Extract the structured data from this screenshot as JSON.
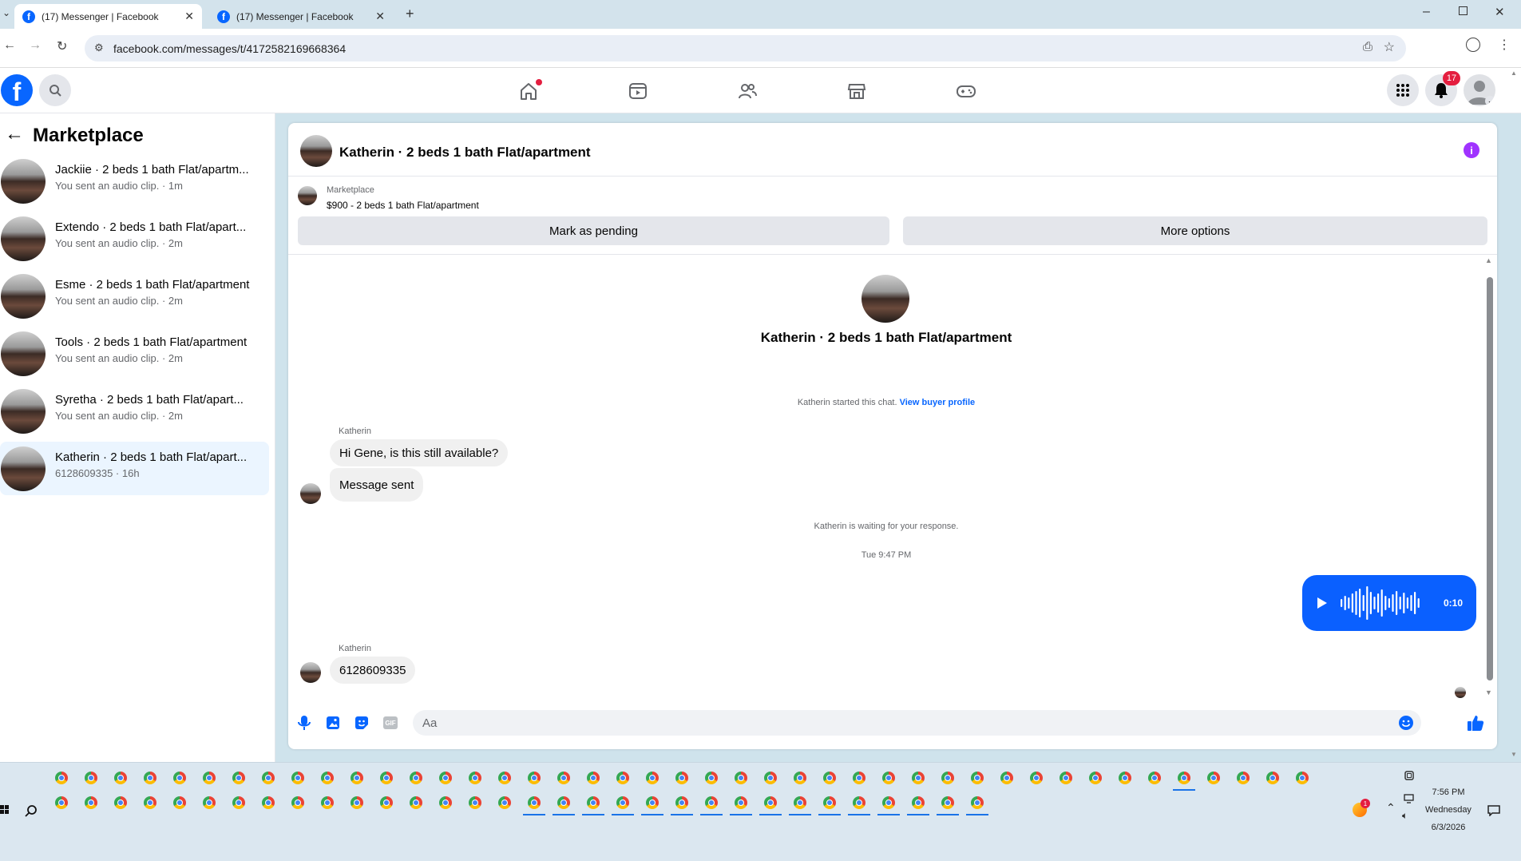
{
  "browser": {
    "tabs": [
      {
        "label": "(17) Messenger | Facebook",
        "active": true
      },
      {
        "label": "(17) Messenger | Facebook",
        "active": false
      }
    ],
    "url": "facebook.com/messages/t/4172582169668364"
  },
  "fb_header": {
    "notification_count": "17"
  },
  "sidebar": {
    "title": "Marketplace",
    "conversations": [
      {
        "name": "Jackiie · 2 beds 1 bath Flat/apartm...",
        "sub": "You sent an audio clip. · 1m"
      },
      {
        "name": "Extendo · 2 beds 1 bath Flat/apart...",
        "sub": "You sent an audio clip. · 2m"
      },
      {
        "name": "Esme · 2 beds 1 bath Flat/apartment",
        "sub": "You sent an audio clip. · 2m"
      },
      {
        "name": "Tools · 2 beds 1 bath Flat/apartment",
        "sub": "You sent an audio clip. · 2m"
      },
      {
        "name": "Syretha · 2 beds 1 bath Flat/apart...",
        "sub": "You sent an audio clip. · 2m"
      },
      {
        "name": "Katherin · 2 beds 1 bath Flat/apart...",
        "sub": "6128609335 · 16h",
        "selected": true
      }
    ]
  },
  "chat": {
    "header_title": "Katherin · 2 beds 1 bath Flat/apartment",
    "listing_source": "Marketplace",
    "listing_title": "$900 - 2 beds 1 bath Flat/apartment",
    "mark_pending_label": "Mark as pending",
    "more_options_label": "More options",
    "profile_name": "Katherin · 2 beds 1 bath Flat/apartment",
    "started_text": "Katherin started this chat.",
    "view_profile_link": "View buyer profile",
    "sender_label_1": "Katherin",
    "message_1": "Hi Gene, is this still available?",
    "message_2": "Message sent",
    "waiting_text": "Katherin is waiting for your response.",
    "timestamp": "Tue 9:47 PM",
    "audio_duration": "0:10",
    "sender_label_2": "Katherin",
    "message_3": "6128609335",
    "composer_placeholder": "Aa"
  },
  "taskbar": {
    "time": "7:56 PM",
    "day": "Wednesday",
    "date": "6/3/2026",
    "tray_badge": "1"
  },
  "colors": {
    "fb_blue": "#0866ff",
    "audio_bubble": "#0a60ff",
    "notification_red": "#e41e3f",
    "info_purple": "#a033ff"
  }
}
